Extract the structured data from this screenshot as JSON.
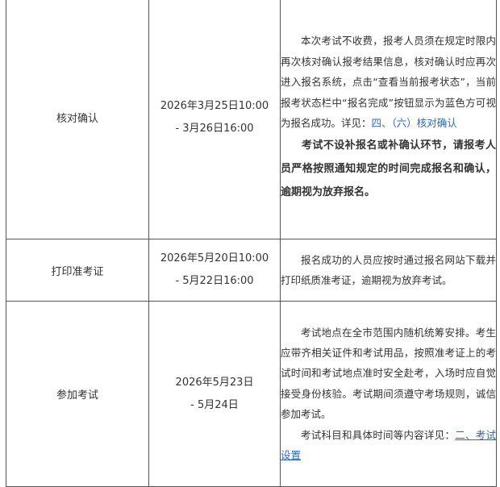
{
  "rows": [
    {
      "stage": "核对确认",
      "time_line1": "2026年3月25日10:00",
      "time_line2": "- 3月26日16:00",
      "desc_p1": "本次考试不收费，报考人员须在规定时限内再次核对确认报考结果信息，核对确认时应再次进入报名系统，点击“查看当前报考状态”，当前报考状态栏中“报名完成”按钮显示为蓝色方可视为报名成功。详见：",
      "desc_link": "四、（六）核对确认",
      "desc_bold": "考试不设补报名或补确认环节，请报考人员严格按照通知规定的时间完成报名和确认，逾期视为放弃报名。"
    },
    {
      "stage": "打印准考证",
      "time_line1": "2026年5月20日10:00",
      "time_line2": "- 5月22日16:00",
      "desc_p1": "报名成功的人员应按时通过报名网站下载并打印纸质准考证，逾期视为放弃考试。"
    },
    {
      "stage": "参加考试",
      "time_line1": "2026年5月23日",
      "time_line2": "- 5月24日",
      "desc_p1": "考试地点在全市范围内随机统筹安排。考生应带齐相关证件和考试用品，按照准考证上的考试时间和考试地点准时安全赴考，入场时应自觉接受身份核验。考试期间须遵守考场规则，诚信参加考试。",
      "desc_p2": "考试科目和具体时间等内容详见：",
      "desc_link": "二、考试设置"
    }
  ]
}
